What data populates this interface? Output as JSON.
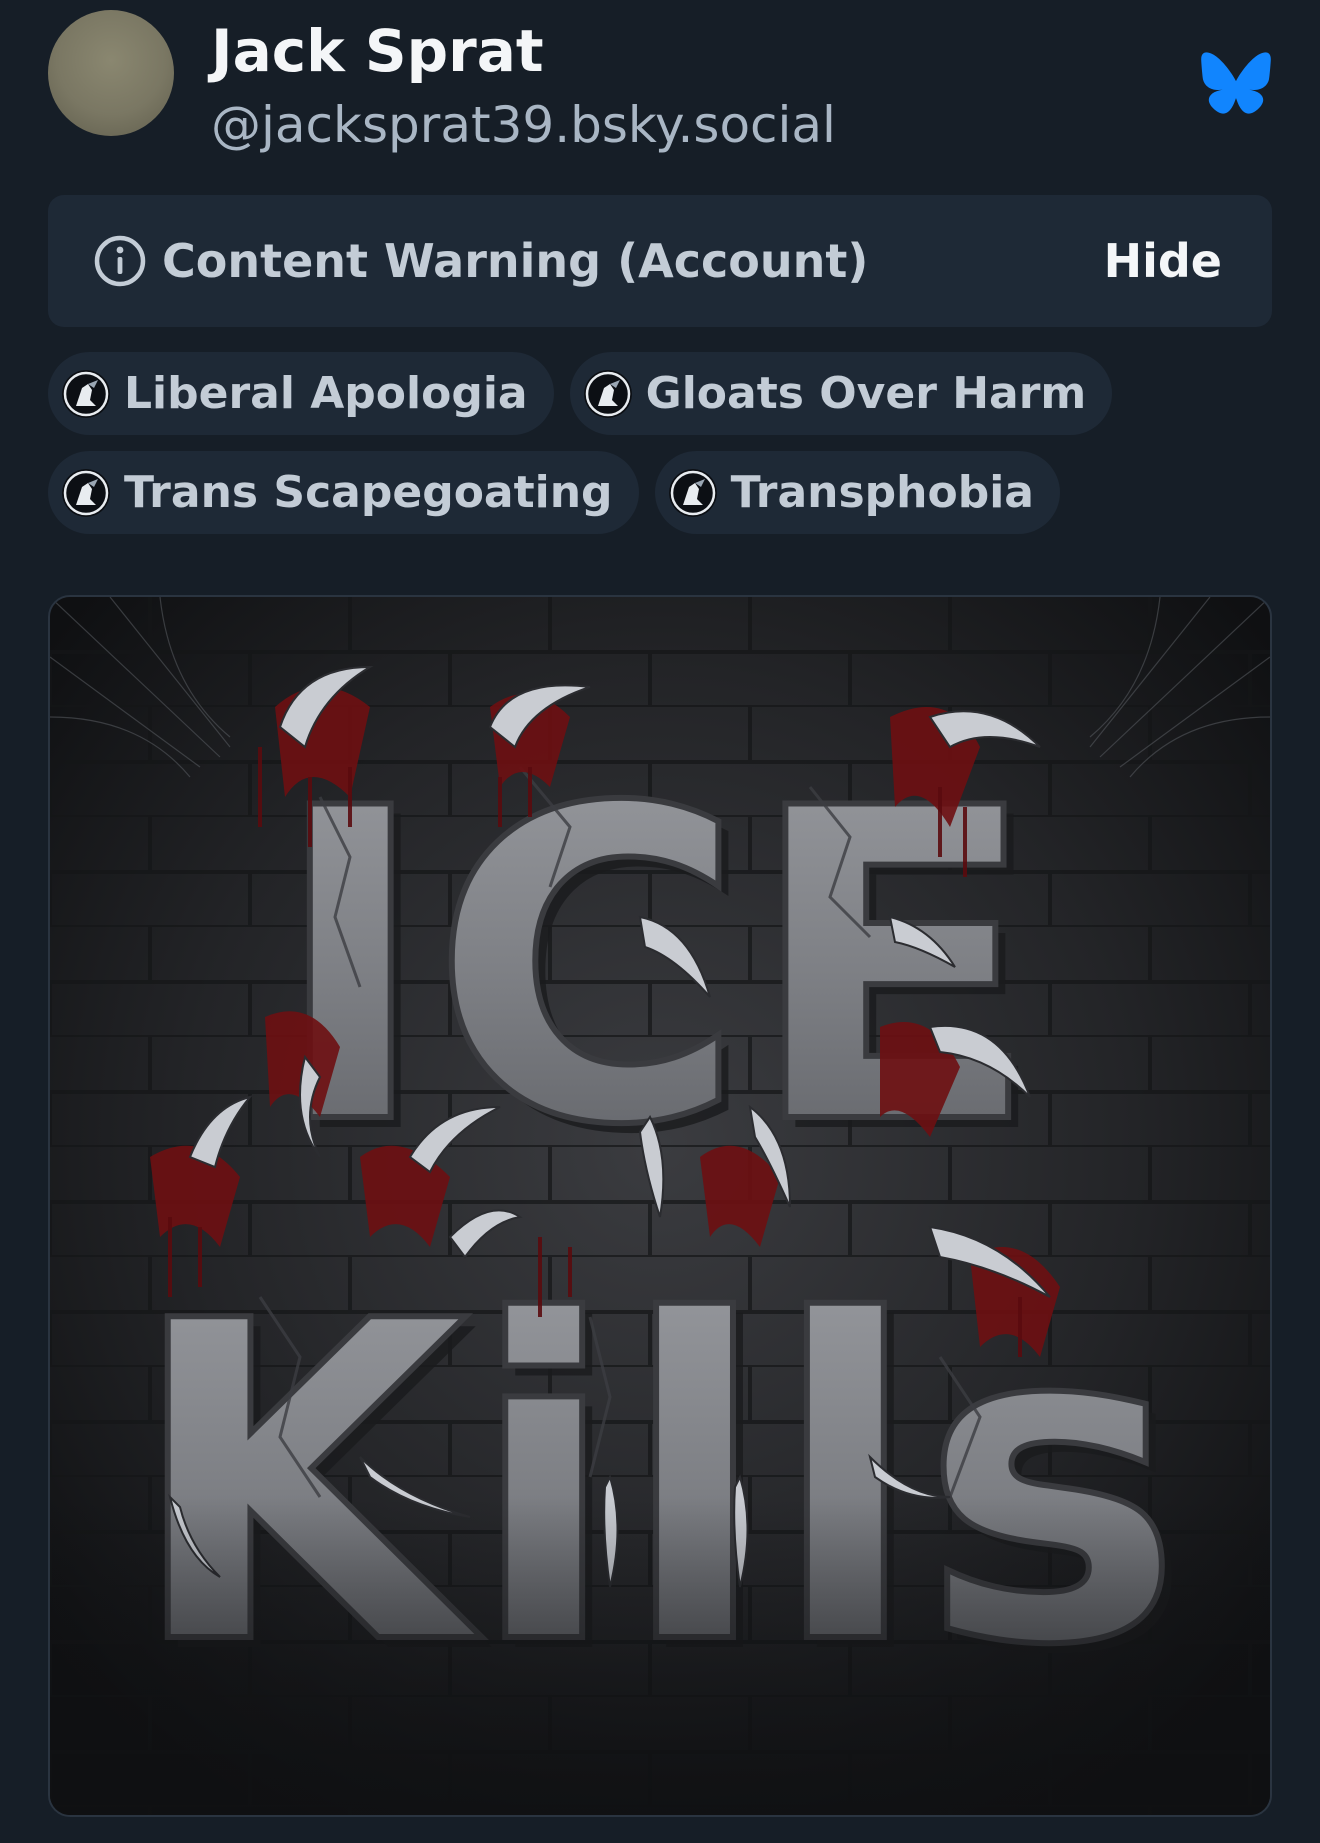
{
  "author": {
    "display_name": "Jack Sprat",
    "handle": "@jacksprat39.bsky.social"
  },
  "app_icon": "bluesky-butterfly-icon",
  "content_warning": {
    "label": "Content Warning (Account)",
    "action": "Hide"
  },
  "labels": [
    {
      "text": "Liberal Apologia"
    },
    {
      "text": "Gloats Over Harm"
    },
    {
      "text": "Trans Scapegoating"
    },
    {
      "text": "Transphobia"
    }
  ],
  "media": {
    "line1": "ICE",
    "line2": "Kills"
  },
  "colors": {
    "background": "#161e27",
    "card": "#1e2936",
    "bluesky_blue": "#1185fe",
    "muted_text": "#a9b6c4",
    "blood_red": "#6e0f12"
  }
}
